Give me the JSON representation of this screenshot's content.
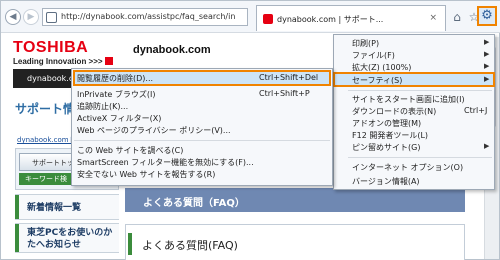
{
  "toolbar": {
    "back_icon": "back-arrow-icon",
    "forward_icon": "forward-arrow-icon",
    "address": "http://dynabook.com/assistpc/faq_search/in",
    "tab_title": "dynabook.com | サポート...",
    "tab_close": "×",
    "home_icon": "⌂",
    "favorites_icon": "☆",
    "tools_icon": "⚙"
  },
  "page": {
    "logo": "TOSHIBA",
    "slogan": "Leading Innovation >>>",
    "site_name": "dynabook.com",
    "darkbar_text": "dynabook.com",
    "support_heading": "サポート情報",
    "breadcrumb": "dynabook.comトップ >",
    "support_button": "サポートトップ",
    "keyword_label": "キーワード検",
    "side_links": [
      "新着情報一覧",
      "東芝PCをお使いのかたへお知らせ"
    ],
    "faq_banner": "よくある質問（FAQ）",
    "faq_heading": "よくある質問(FAQ)"
  },
  "tools_menu": {
    "items": [
      {
        "label": "印刷(P)",
        "arrow": "▶"
      },
      {
        "label": "ファイル(F)",
        "arrow": "▶"
      },
      {
        "label": "拡大(Z) (100%)",
        "arrow": "▶"
      },
      {
        "label": "セーフティ(S)",
        "arrow": "▶"
      },
      {
        "label": "サイトをスタート画面に追加(I)"
      },
      {
        "label": "ダウンロードの表示(N)",
        "shortcut": "Ctrl+J"
      },
      {
        "label": "アドオンの管理(M)"
      },
      {
        "label": "F12 開発者ツール(L)"
      },
      {
        "label": "ピン留めサイト(G)",
        "arrow": "▶"
      },
      {
        "label": "インターネット オプション(O)"
      },
      {
        "label": "バージョン情報(A)"
      }
    ]
  },
  "safety_menu": {
    "items": [
      {
        "label": "閲覧履歴の削除(D)...",
        "shortcut": "Ctrl+Shift+Del"
      },
      {
        "label": "InPrivate ブラウズ(I)",
        "shortcut": "Ctrl+Shift+P"
      },
      {
        "label": "追跡防止(K)..."
      },
      {
        "label": "ActiveX フィルター(X)"
      },
      {
        "label": "Web ページのプライバシー ポリシー(V)..."
      },
      {
        "label": "この Web サイトを調べる(C)"
      },
      {
        "label": "SmartScreen フィルター機能を無効にする(F)..."
      },
      {
        "label": "安全でない Web サイトを報告する(R)"
      }
    ]
  },
  "colors": {
    "highlight_border": "#f08300",
    "highlight_fill": "#cde4f7",
    "brand_red": "#e60012",
    "banner_blue": "#6f88b2"
  }
}
